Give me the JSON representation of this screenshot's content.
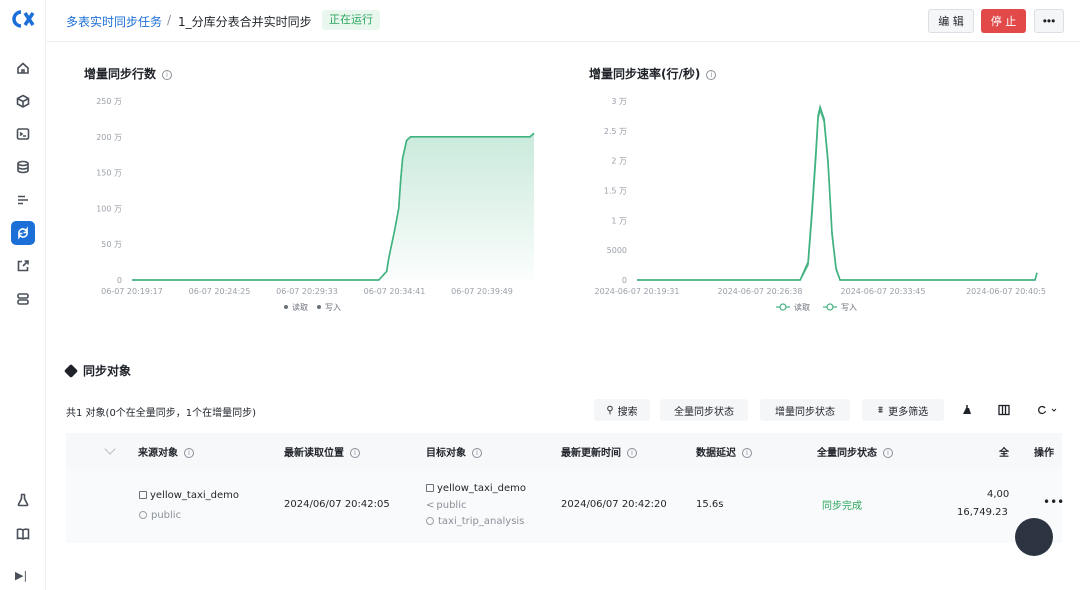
{
  "header": {
    "breadcrumb_parent": "多表实时同步任务",
    "breadcrumb_sep": "/",
    "breadcrumb_current": "1_分库分表合并实时同步",
    "status": "正在运行",
    "edit_label": "编 辑",
    "stop_label": "停 止",
    "more_label": "•••"
  },
  "sidebar": {
    "items": [
      "home-icon",
      "cube-icon",
      "terminal-icon",
      "database-icon",
      "list-icon",
      "sync-icon",
      "export-icon",
      "server-icon",
      "flask-icon",
      "book-icon"
    ],
    "active": "sync-icon",
    "collapse_label": "▶|"
  },
  "charts": {
    "rows_title": "增量同步行数",
    "rate_title": "增量同步速率(行/秒)",
    "legend_read": "读取",
    "legend_write": "写入"
  },
  "chart_data": [
    {
      "type": "area",
      "title": "增量同步行数",
      "y_ticks": [
        "0",
        "50 万",
        "100 万",
        "150 万",
        "200 万",
        "250 万"
      ],
      "ylim": [
        0,
        2500000
      ],
      "x_ticks": [
        "06-07 20:19:17",
        "06-07 20:24:25",
        "06-07 20:29:33",
        "06-07 20:34:41",
        "06-07 20:39:49"
      ],
      "series": [
        {
          "name": "读取",
          "x": [
            0,
            0.62,
            0.64,
            0.645,
            0.66,
            0.67,
            0.675,
            0.68,
            0.69,
            0.7,
            1.0,
            1.01
          ],
          "values": [
            0,
            0,
            120000,
            300000,
            700000,
            1000000,
            1400000,
            1700000,
            1950000,
            2000000,
            2000000,
            2050000
          ]
        },
        {
          "name": "写入",
          "x": [
            0,
            0.62,
            0.64,
            0.645,
            0.66,
            0.67,
            0.675,
            0.68,
            0.69,
            0.7,
            1.0,
            1.01
          ],
          "values": [
            0,
            0,
            120000,
            300000,
            700000,
            1000000,
            1400000,
            1700000,
            1950000,
            2000000,
            2000000,
            2050000
          ]
        }
      ],
      "legend_placement": "bottom",
      "grid": false
    },
    {
      "type": "line",
      "title": "增量同步速率(行/秒)",
      "y_ticks": [
        "0",
        "5000",
        "1 万",
        "1.5 万",
        "2 万",
        "2.5 万",
        "3 万"
      ],
      "ylim": [
        0,
        30000
      ],
      "x_ticks": [
        "2024-06-07 20:19:31",
        "2024-06-07 20:26:38",
        "2024-06-07 20:33:45",
        "2024-06-07 20:40:5"
      ],
      "series": [
        {
          "name": "读取",
          "x": [
            0,
            0.41,
            0.43,
            0.44,
            0.45,
            0.455,
            0.46,
            0.47,
            0.48,
            0.485,
            0.49,
            0.5,
            0.51,
            1.0,
            1.005
          ],
          "values": [
            0,
            0,
            3000,
            12000,
            22000,
            27500,
            29000,
            27000,
            20000,
            14000,
            8000,
            2000,
            0,
            0,
            1200
          ]
        },
        {
          "name": "写入",
          "x": [
            0,
            0.41,
            0.43,
            0.44,
            0.45,
            0.455,
            0.46,
            0.47,
            0.48,
            0.485,
            0.49,
            0.5,
            0.51,
            1.0,
            1.005
          ],
          "values": [
            0,
            0,
            2500,
            11000,
            21000,
            27000,
            28500,
            26500,
            19500,
            13500,
            7500,
            1800,
            0,
            0,
            1200
          ]
        }
      ],
      "legend_placement": "bottom",
      "grid": false
    }
  ],
  "section": {
    "title": "同步对象",
    "summary": "共1 对象(0个在全量同步，1个在增量同步)"
  },
  "toolbar": {
    "search_label": "搜索",
    "full_sync_filter": "全量同步状态",
    "incr_sync_filter": "增量同步状态",
    "more_filter": "更多筛选"
  },
  "table": {
    "headers": {
      "source": "来源对象",
      "read_pos": "最新读取位置",
      "target": "目标对象",
      "update_time": "最新更新时间",
      "latency": "数据延迟",
      "full_status": "全量同步状态",
      "partial": "全",
      "actions": "操作"
    },
    "row": {
      "source_table": "yellow_taxi_demo",
      "source_schema": "public",
      "read_pos": "2024/06/07 20:42:05",
      "target_table": "yellow_taxi_demo",
      "target_schema": "public",
      "target_db": "taxi_trip_analysis",
      "update_time": "2024/06/07 20:42:20",
      "latency": "15.6s",
      "full_status": "同步完成",
      "count1": "4,00",
      "count2": "16,749.23",
      "more": "•••"
    }
  },
  "colors": {
    "accent": "#1d6fd8",
    "line": "#3fb27f",
    "danger": "#e24a4a",
    "success": "#2aa65d"
  }
}
